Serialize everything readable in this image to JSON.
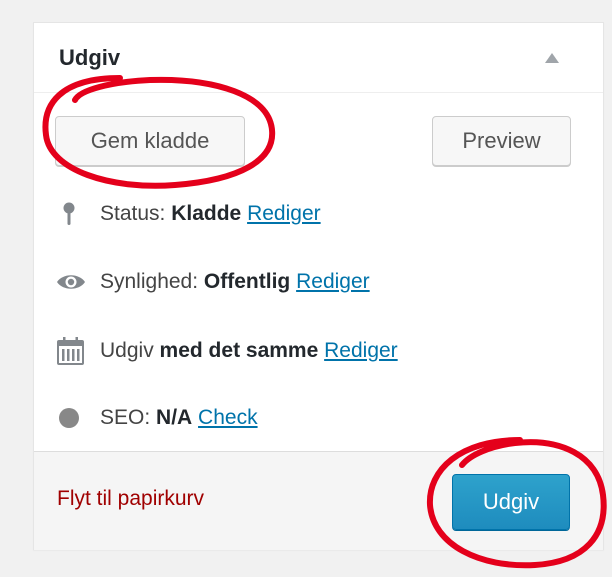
{
  "box": {
    "title": "Udgiv",
    "toggle_icon": "triangle-up-icon"
  },
  "actions": {
    "save_draft_label": "Gem kladde",
    "preview_label": "Preview"
  },
  "misc": {
    "status": {
      "label": "Status:",
      "value": "Kladde",
      "edit": "Rediger",
      "icon": "pin-icon"
    },
    "visibility": {
      "label": "Synlighed:",
      "value": "Offentlig",
      "edit": "Rediger",
      "icon": "eye-icon"
    },
    "publish": {
      "label": "Udgiv",
      "value": "med det samme",
      "edit": "Rediger",
      "icon": "calendar-icon"
    },
    "seo": {
      "label": "SEO:",
      "value": "N/A",
      "edit": "Check",
      "icon": "circle-icon"
    }
  },
  "footer": {
    "trash_label": "Flyt til papirkurv",
    "publish_label": "Udgiv"
  },
  "colors": {
    "link": "#0073aa",
    "trash": "#a00000",
    "primary": "#0085ba",
    "annotation": "#e4001b"
  }
}
